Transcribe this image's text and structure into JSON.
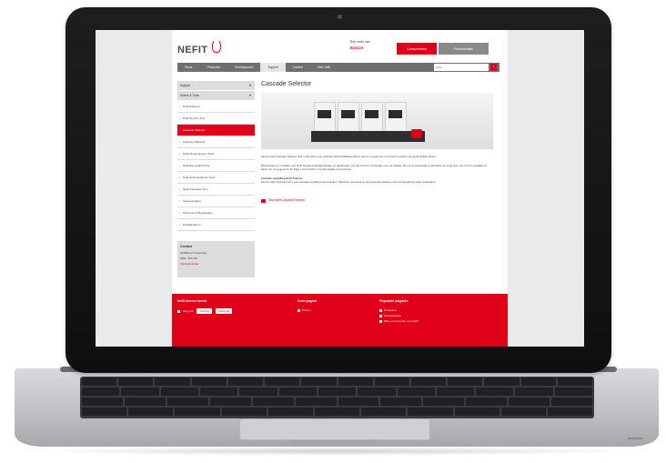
{
  "website": {
    "brand": "NEFIT",
    "bosch_intro": "Een merk van",
    "bosch_name": "BOSCH",
    "btn_consumers": "Consumenten",
    "btn_professionals": "Professionals",
    "nav": [
      "Home",
      "Producten",
      "Servicepunten",
      "Support",
      "Contact",
      "Over Nefit"
    ],
    "search_placeholder": "Zoek",
    "sidebar_selects": [
      "Support",
      "Advies & Tools"
    ],
    "sidebar_items": [
      "Nefit Adviseur",
      "Nefit Service Tool",
      "Cascade Selector",
      "Adviezen Bekend",
      "Nefit Dimensionere Tools",
      "Nefit Erp-toolkit Tools",
      "Nefit Zonnecollector Tools",
      "Nefit Calculator Tool",
      "Gasverbruiken",
      "Schema's & Bepalingen",
      "Praktijkvideo's"
    ],
    "contact_title": "Contact",
    "contact_lines": [
      "Nefit/Bosch Supportline",
      "0800 - 800 100"
    ],
    "contact_link": "Contactformulier",
    "page_title": "Cascade Selector",
    "para1": "Met de Nefit Cascade Selector stelt u zelf online een optimale Nefit installatieontwerp samen in geval van 2 of meer cv-ketels met gezamenlijke afvoer.",
    "para2": "Bouwkosten en montage, een Nefit programmabelijk bepalen en aanbevelen van de correcte combinatie voor uw situatie. De tool is eenvoudig te gebruiken en zorgt voor een correct resultaat op basis van uw gegevens. Zo krijgt u snel inzicht in de benodigde componenten.",
    "para3_title": "Cascade-opstelling Nefit TopLine",
    "para3": "Met de Nefit TopLine kunt u een cascade-opstelling samenstellen. Selecteer uw ketels en het gewenste aantal en de tool bepaalt de juiste onderdelen.",
    "download": "Start Nefit Cascade Selector",
    "footer_col1_title": "Nefit binnen bereik",
    "footer_social": [
      "Volg ons",
      "YouTube",
      "Facebook"
    ],
    "footer_col2_title": "Deze pagina",
    "footer_col2_links": [
      "Printen"
    ],
    "footer_col3_title": "Populaire pagina's",
    "footer_col3_links": [
      "Producten",
      "Servicepunten",
      "Wat u moet weten over Nefit"
    ]
  },
  "colors": {
    "brand_red": "#e1001a",
    "nav_gray": "#6f6f6f"
  }
}
